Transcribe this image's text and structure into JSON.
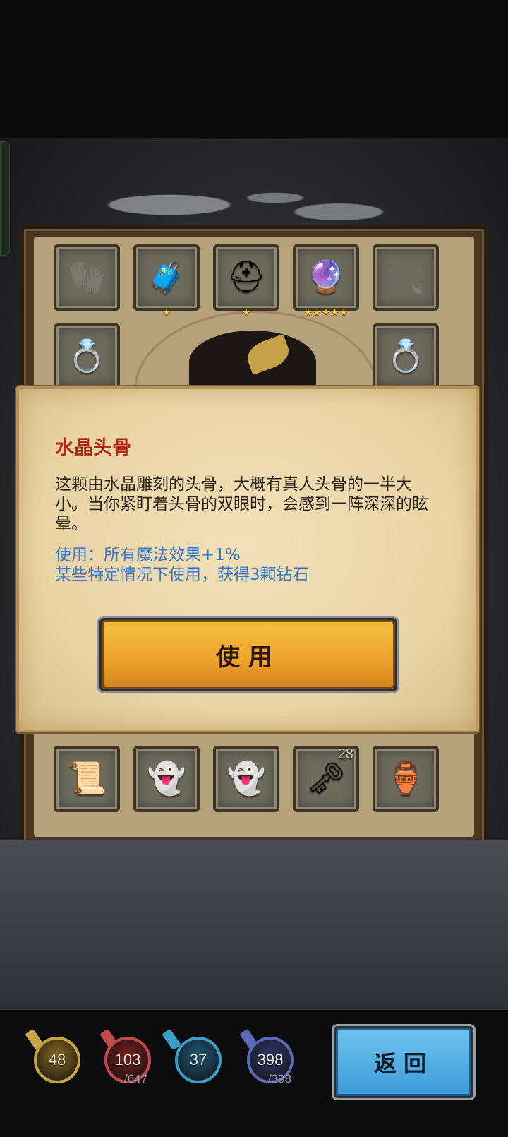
{
  "inventory": {
    "slots": [
      {
        "icon": "glove-icon",
        "glyph": "🧤",
        "stars": "",
        "count": "",
        "empty": true
      },
      {
        "icon": "armor-chest-icon",
        "glyph": "🧳",
        "stars": "★",
        "count": ""
      },
      {
        "icon": "helmet-icon",
        "glyph": "⛑",
        "stars": "★",
        "count": ""
      },
      {
        "icon": "dark-lantern-icon",
        "glyph": "🔮",
        "stars": "★★★★★",
        "count": ""
      },
      {
        "icon": "necklace-icon",
        "glyph": "📿",
        "stars": "",
        "count": "",
        "empty": true
      },
      {
        "icon": "bracelet-icon",
        "glyph": "💍",
        "stars": "★",
        "count": ""
      },
      {
        "icon": "ring-icon",
        "glyph": "💍",
        "stars": "★★",
        "count": ""
      },
      {
        "icon": "scroll-icon",
        "glyph": "📜",
        "stars": "",
        "count": ""
      },
      {
        "icon": "ghost-icon",
        "glyph": "👻",
        "stars": "",
        "count": ""
      },
      {
        "icon": "ghost-icon",
        "glyph": "👻",
        "stars": "",
        "count": ""
      },
      {
        "icon": "key-card-icon",
        "glyph": "🗝",
        "stars": "",
        "count": "28"
      },
      {
        "icon": "potion-icon",
        "glyph": "🏺",
        "stars": "",
        "count": ""
      }
    ]
  },
  "dialog": {
    "item_name": "水晶头骨",
    "description": "这颗由水晶雕刻的头骨，大概有真人头骨的一半大小。当你紧盯着头骨的双眼时，会感到一阵深深的眩晕。",
    "effect_line1": "使用：所有魔法效果+1%",
    "effect_line2": "某些特定情况下使用，获得3颗钻石",
    "use_button": "使用"
  },
  "stats": [
    {
      "name": "gold-stat",
      "value": "48",
      "max": "",
      "color": "#8a6a1e",
      "ring": "#c9a444"
    },
    {
      "name": "hp-stat",
      "value": "103",
      "max": "/647",
      "color": "#7a1e22",
      "ring": "#c44a4a"
    },
    {
      "name": "mana-stat",
      "value": "37",
      "max": "",
      "color": "#1e5a7a",
      "ring": "#3aa0c8"
    },
    {
      "name": "energy-stat",
      "value": "398",
      "max": "/398",
      "color": "#2e3a6a",
      "ring": "#5a6ab8"
    }
  ],
  "back_button": "返回"
}
